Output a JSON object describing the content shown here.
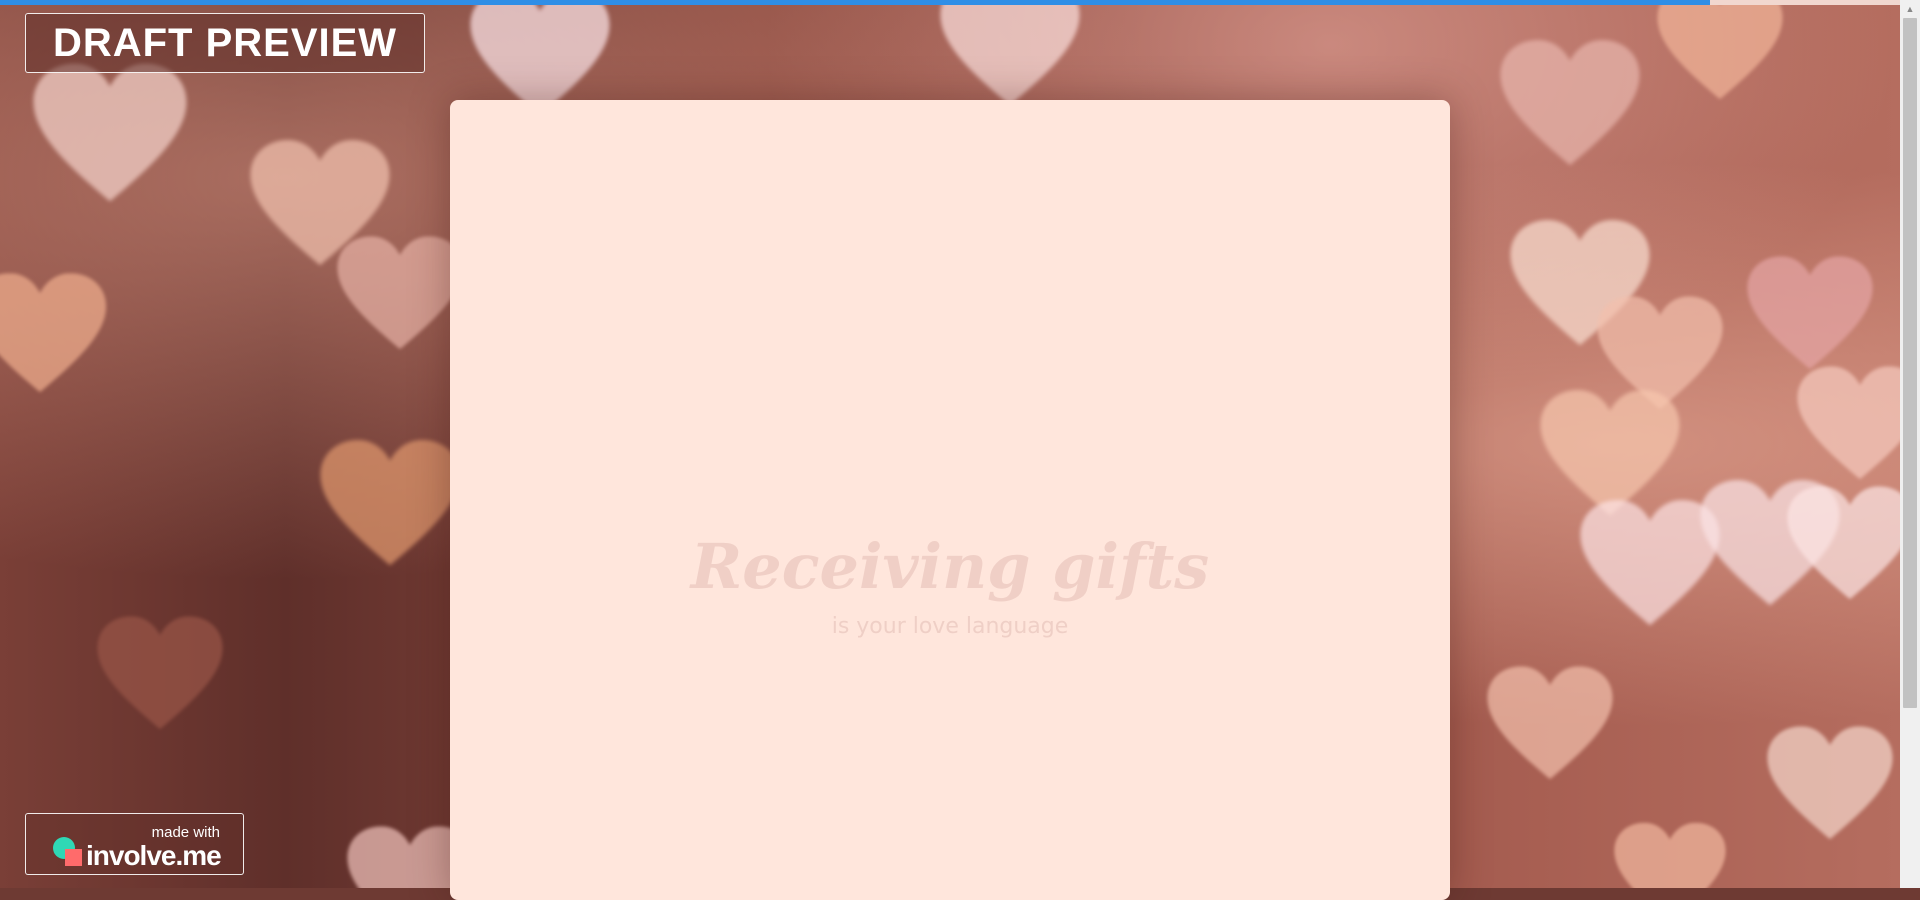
{
  "header": {
    "draft_label": "DRAFT PREVIEW",
    "progress_fraction": 0.9
  },
  "card": {
    "title": "Receiving gifts",
    "subtitle": "is your love language"
  },
  "badge": {
    "made_with": "made with",
    "brand": "involve.me",
    "logo_icon": "involve-me-logo-icon"
  },
  "colors": {
    "card_bg": "#ffe6dc",
    "progress": "#2f8ee6",
    "title": "#f0cfc6"
  },
  "background_icon": "hearts-bokeh-background"
}
